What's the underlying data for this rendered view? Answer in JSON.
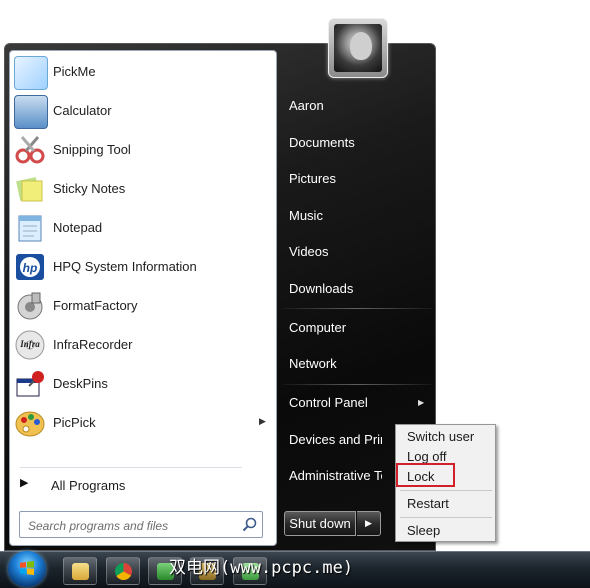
{
  "user": {
    "name": "Aaron",
    "avatar_icon": "user-avatar-icon"
  },
  "programs": [
    {
      "label": "PickMe",
      "icon": "pickme-icon",
      "color": "#9fd1ff"
    },
    {
      "label": "Calculator",
      "icon": "calculator-icon",
      "color": "#5a8fc8"
    },
    {
      "label": "Snipping Tool",
      "icon": "scissors-icon",
      "color": "#d24a4a"
    },
    {
      "label": "Sticky Notes",
      "icon": "sticky-notes-icon",
      "color": "#e8e66a"
    },
    {
      "label": "Notepad",
      "icon": "notepad-icon",
      "color": "#7fb3e0"
    },
    {
      "label": "HPQ System Information",
      "icon": "hp-icon",
      "color": "#1a4fa0"
    },
    {
      "label": "FormatFactory",
      "icon": "format-factory-icon",
      "color": "#8a8a8a"
    },
    {
      "label": "InfraRecorder",
      "icon": "infrarecorder-icon",
      "color": "#3a3a3a"
    },
    {
      "label": "DeskPins",
      "icon": "deskpins-icon",
      "color": "#d02020"
    },
    {
      "label": "PicPick",
      "icon": "picpick-icon",
      "color": "#e8b030",
      "submenu": true
    }
  ],
  "all_programs": "All Programs",
  "search": {
    "placeholder": "Search programs and files"
  },
  "right_links": [
    "Aaron",
    "Documents",
    "Pictures",
    "Music",
    "Videos",
    "Downloads",
    "Computer",
    "Network",
    "Control Panel",
    "Devices and Printers",
    "Administrative Tools"
  ],
  "shutdown": {
    "label": "Shut down"
  },
  "power_menu": [
    "Switch user",
    "Log off",
    "Lock",
    "Restart",
    "Sleep"
  ],
  "highlighted_item": "Lock",
  "watermark": "双电网(www.pcpc.me)",
  "taskbar_icons": [
    "explorer-icon",
    "chrome-icon",
    "app-icon",
    "fm-icon",
    "printer-icon"
  ],
  "colors": {
    "highlight": "#d0202a",
    "accent": "#1c7fd6"
  }
}
